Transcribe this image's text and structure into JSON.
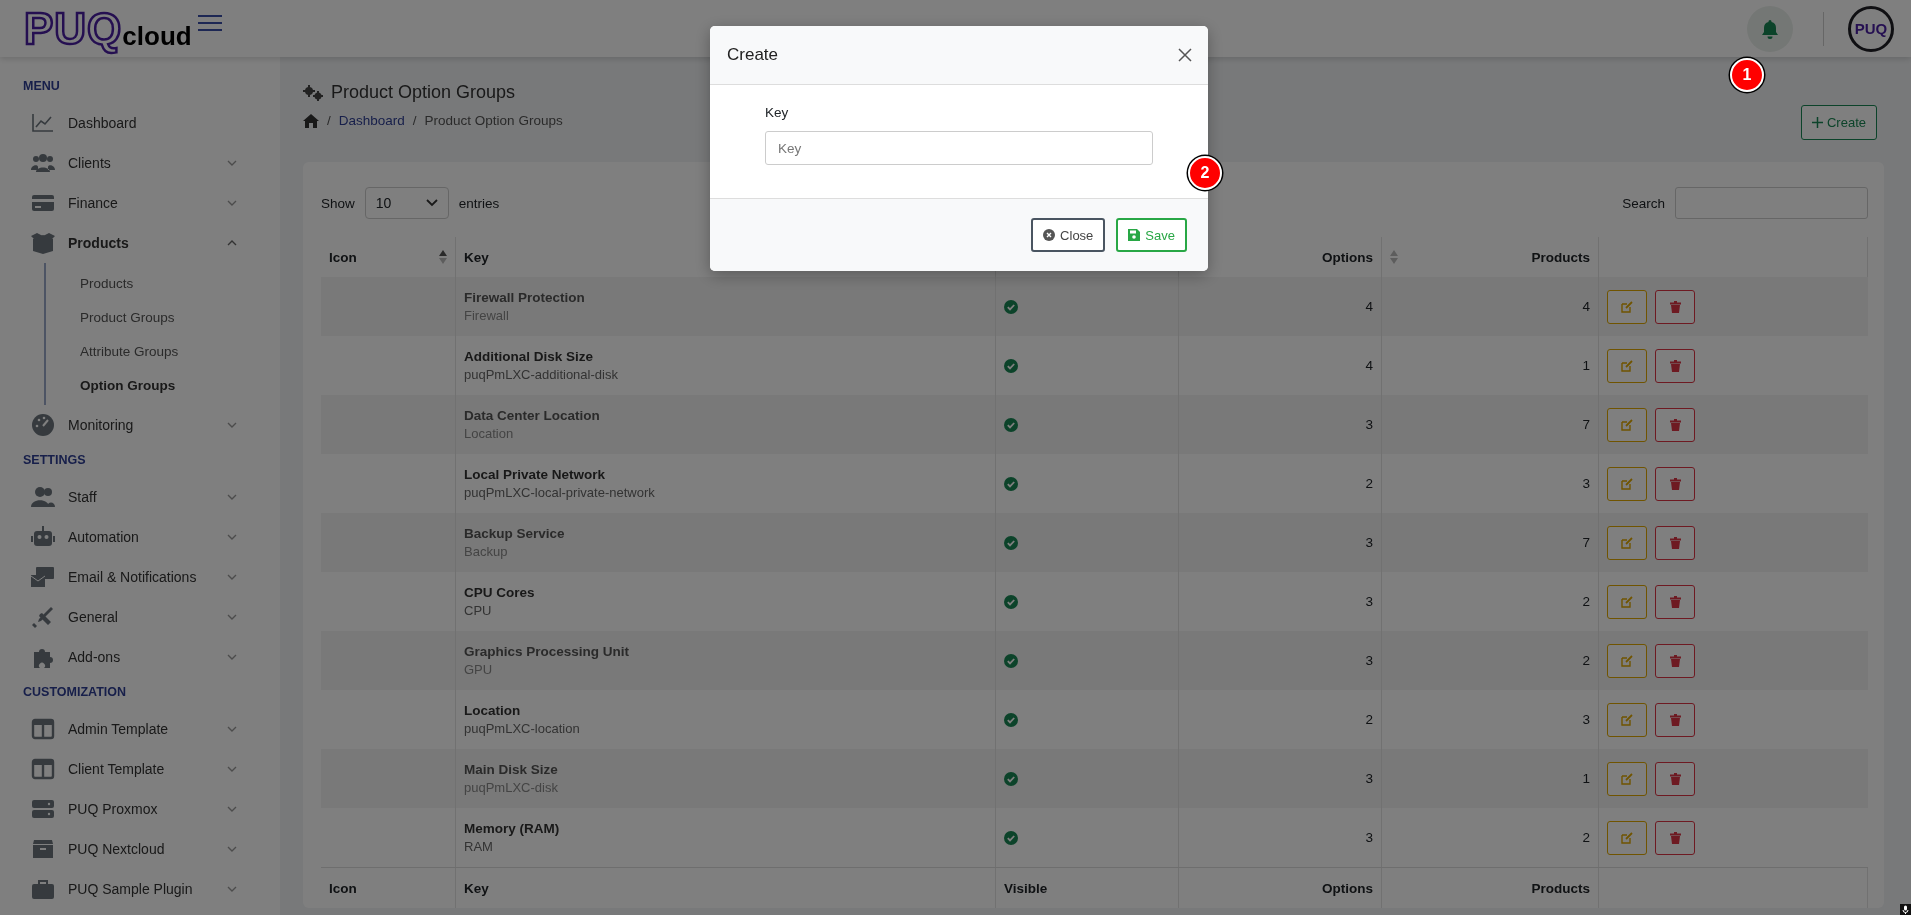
{
  "logo": {
    "brand": "PUQ",
    "suffix": "cloud"
  },
  "header": {
    "avatar": "PUQ",
    "notification_marker": "1"
  },
  "sidebar": {
    "sections": [
      {
        "title": "MENU",
        "items": [
          {
            "label": "Dashboard",
            "expandable": false,
            "selected": false
          },
          {
            "label": "Clients",
            "expandable": true,
            "expanded": false,
            "selected": false
          },
          {
            "label": "Finance",
            "expandable": true,
            "expanded": false,
            "selected": false
          },
          {
            "label": "Products",
            "expandable": true,
            "expanded": true,
            "selected": true,
            "children": [
              {
                "label": "Products",
                "selected": false
              },
              {
                "label": "Product Groups",
                "selected": false
              },
              {
                "label": "Attribute Groups",
                "selected": false
              },
              {
                "label": "Option Groups",
                "selected": true
              }
            ]
          },
          {
            "label": "Monitoring",
            "expandable": true,
            "expanded": false,
            "selected": false
          }
        ]
      },
      {
        "title": "SETTINGS",
        "items": [
          {
            "label": "Staff",
            "expandable": true,
            "expanded": false,
            "selected": false
          },
          {
            "label": "Automation",
            "expandable": true,
            "expanded": false,
            "selected": false
          },
          {
            "label": "Email & Notifications",
            "expandable": true,
            "expanded": false,
            "selected": false
          },
          {
            "label": "General",
            "expandable": true,
            "expanded": false,
            "selected": false
          },
          {
            "label": "Add-ons",
            "expandable": true,
            "expanded": false,
            "selected": false
          }
        ]
      },
      {
        "title": "CUSTOMIZATION",
        "items": [
          {
            "label": "Admin Template",
            "expandable": true,
            "expanded": false,
            "selected": false
          },
          {
            "label": "Client Template",
            "expandable": true,
            "expanded": false,
            "selected": false
          },
          {
            "label": "PUQ Proxmox",
            "expandable": true,
            "expanded": false,
            "selected": false
          },
          {
            "label": "PUQ Nextcloud",
            "expandable": true,
            "expanded": false,
            "selected": false
          },
          {
            "label": "PUQ Sample Plugin",
            "expandable": true,
            "expanded": false,
            "selected": false
          }
        ]
      }
    ]
  },
  "page": {
    "title": "Product Option Groups",
    "breadcrumb": [
      {
        "kind": "separator",
        "label": "/"
      },
      {
        "kind": "link",
        "label": "Dashboard"
      },
      {
        "kind": "separator",
        "label": "/"
      },
      {
        "kind": "current",
        "label": "Product Option Groups"
      }
    ],
    "create_button": "Create"
  },
  "table_controls": {
    "show_label": "Show",
    "page_size": "10",
    "entries_label": "entries",
    "search_label": "Search"
  },
  "table": {
    "header": [
      {
        "kind": "sorted",
        "label": "Icon"
      },
      {
        "kind": "text",
        "label": "Key"
      },
      {
        "kind": "covered"
      },
      {
        "kind": "text",
        "label": "Options"
      },
      {
        "kind": "sortable",
        "label": "Products"
      },
      {
        "kind": "covered"
      }
    ],
    "rows": [
      {
        "name": "Firewall Protection",
        "key": "Firewall",
        "visible": true,
        "options": "4",
        "products": "4"
      },
      {
        "name": "Additional Disk Size",
        "key": "puqPmLXC-additional-disk",
        "visible": true,
        "options": "4",
        "products": "1"
      },
      {
        "name": "Data Center Location",
        "key": "Location",
        "visible": true,
        "options": "3",
        "products": "7"
      },
      {
        "name": "Local Private Network",
        "key": "puqPmLXC-local-private-network",
        "visible": true,
        "options": "2",
        "products": "3"
      },
      {
        "name": "Backup Service",
        "key": "Backup",
        "visible": true,
        "options": "3",
        "products": "7"
      },
      {
        "name": "CPU Cores",
        "key": "CPU",
        "visible": true,
        "options": "3",
        "products": "2"
      },
      {
        "name": "Graphics Processing Unit",
        "key": "GPU",
        "visible": true,
        "options": "3",
        "products": "2"
      },
      {
        "name": "Location",
        "key": "puqPmLXC-location",
        "visible": true,
        "options": "2",
        "products": "3"
      },
      {
        "name": "Main Disk Size",
        "key": "puqPmLXC-disk",
        "visible": true,
        "options": "3",
        "products": "1"
      },
      {
        "name": "Memory (RAM)",
        "key": "RAM",
        "visible": true,
        "options": "3",
        "products": "2"
      }
    ],
    "footer": [
      "Icon",
      "Key",
      "Visible",
      "Options",
      "Products"
    ]
  },
  "modal": {
    "title": "Create",
    "field_label": "Key",
    "field_placeholder": "Key",
    "marker": "2",
    "buttons": [
      {
        "kind": "close",
        "label": "Close"
      },
      {
        "kind": "save",
        "label": "Save"
      }
    ]
  }
}
